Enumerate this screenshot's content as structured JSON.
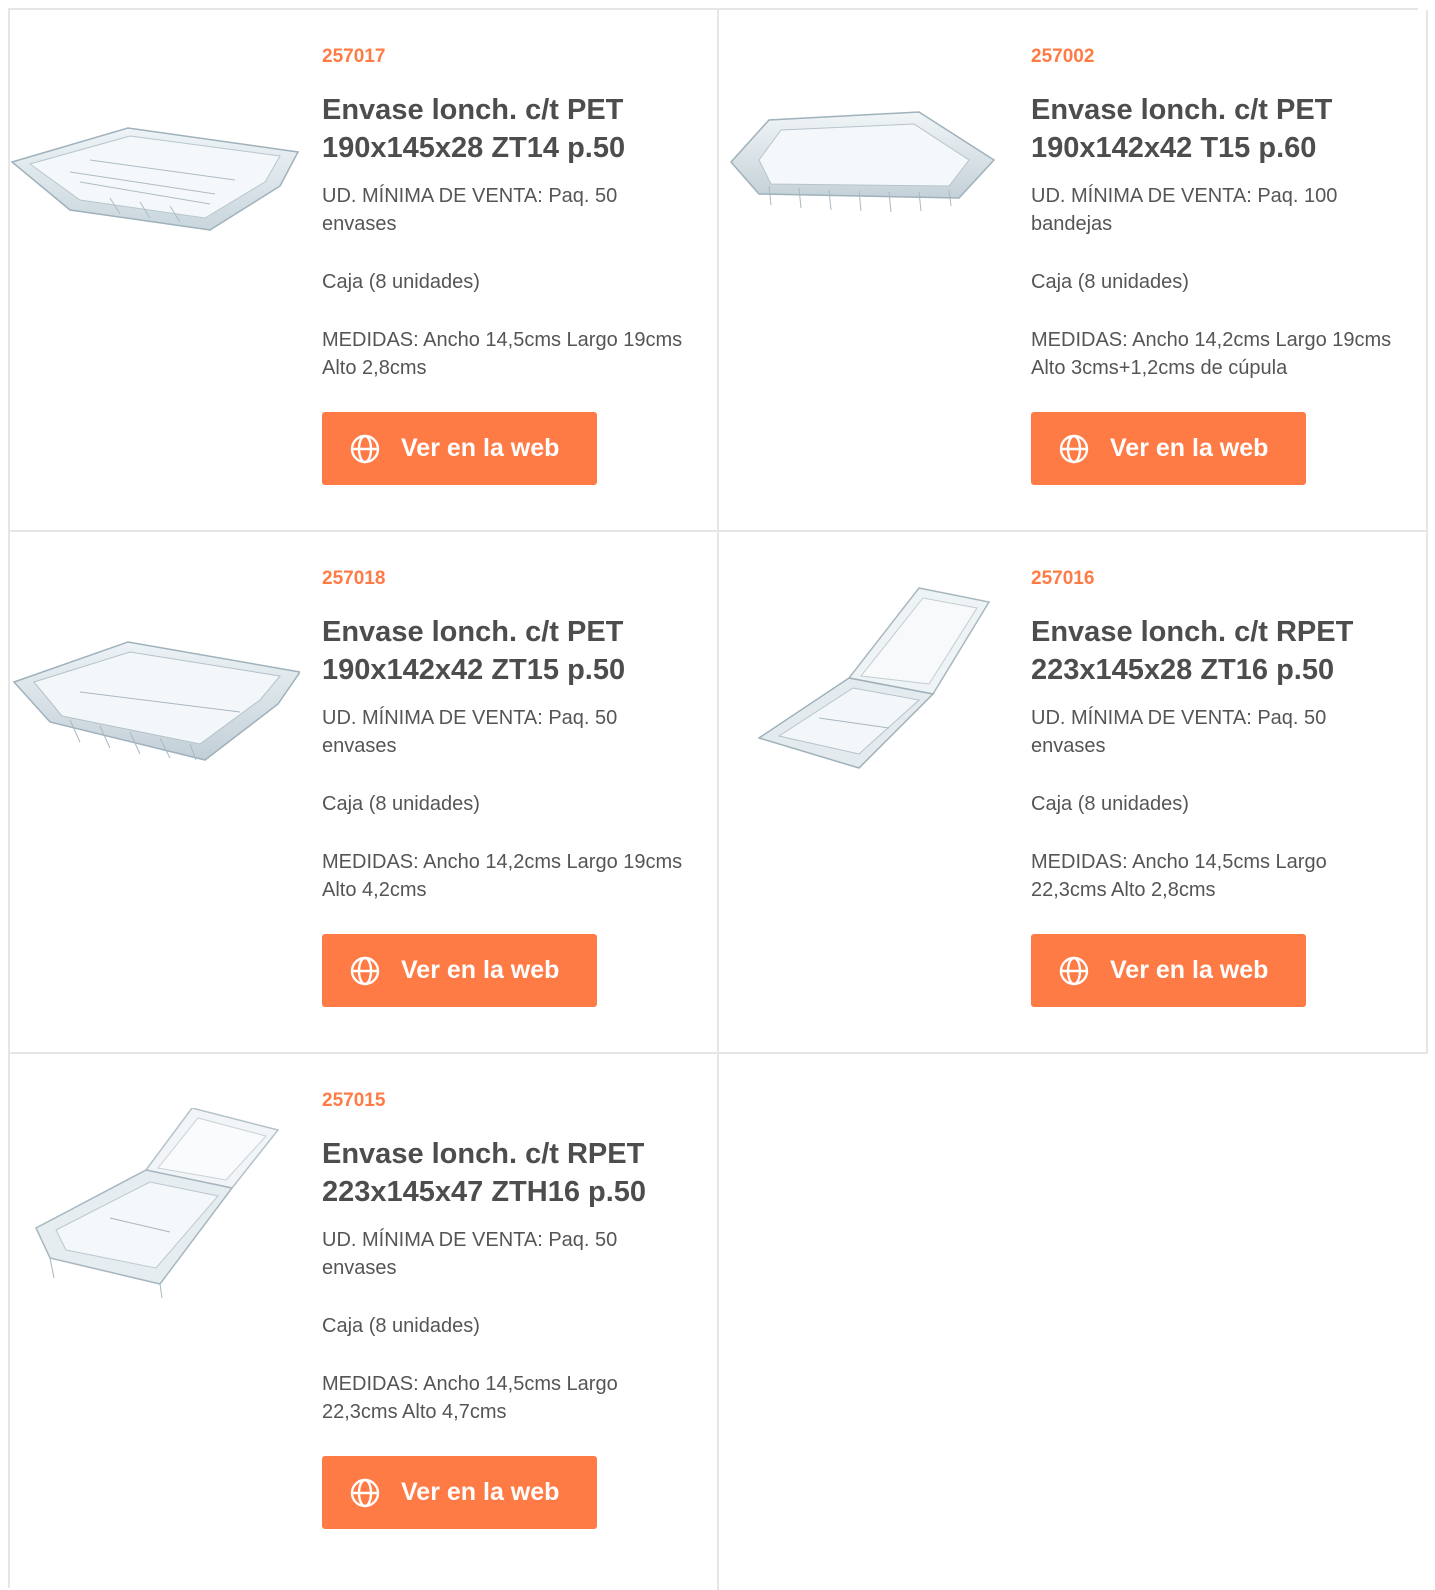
{
  "brand": {
    "accent": "#ff7b45",
    "title_color": "#4d4d4d",
    "text_color": "#555555",
    "border": "#e6e6e6"
  },
  "products": [
    {
      "code": "257017",
      "name": "Envase lonch. c/t PET 190x145x28 ZT14 p.50",
      "min_sale": "UD. MÍNIMA DE VENTA:  Paq. 50 envases",
      "box": "Caja (8 unidades)",
      "measures": "MEDIDAS:  Ancho 14,5cms Largo 19cms Alto 2,8cms",
      "button_label": "Ver en la web",
      "image": "clear-tray-flat"
    },
    {
      "code": "257002",
      "name": "Envase lonch. c/t PET 190x142x42 T15 p.60",
      "min_sale": "UD. MÍNIMA DE VENTA:  Paq. 100 bandejas",
      "box": "Caja (8 unidades)",
      "measures": "MEDIDAS:  Ancho 14,2cms Largo 19cms Alto 3cms+1,2cms de cúpula",
      "button_label": "Ver en la web",
      "image": "clear-tray-domed"
    },
    {
      "code": "257018",
      "name": "Envase lonch. c/t PET 190x142x42 ZT15 p.50",
      "min_sale": "UD. MÍNIMA DE VENTA:  Paq. 50 envases",
      "box": "Caja (8 unidades)",
      "measures": "MEDIDAS:  Ancho 14,2cms Largo 19cms Alto 4,2cms",
      "button_label": "Ver en la web",
      "image": "clear-tray-deep"
    },
    {
      "code": "257016",
      "name": "Envase lonch. c/t RPET 223x145x28 ZT16 p.50",
      "min_sale": "UD. MÍNIMA DE VENTA:  Paq. 50 envases",
      "box": "Caja (8 unidades)",
      "measures": "MEDIDAS:  Ancho 14,5cms Largo 22,3cms Alto 2,8cms",
      "button_label": "Ver en la web",
      "image": "clear-clamshell-open"
    },
    {
      "code": "257015",
      "name": "Envase lonch. c/t RPET 223x145x47 ZTH16 p.50",
      "min_sale": "UD. MÍNIMA DE VENTA:  Paq. 50 envases",
      "box": "Caja (8 unidades)",
      "measures": "MEDIDAS:  Ancho 14,5cms Largo 22,3cms Alto 4,7cms",
      "button_label": "Ver en la web",
      "image": "clear-clamshell-open-deep"
    }
  ]
}
